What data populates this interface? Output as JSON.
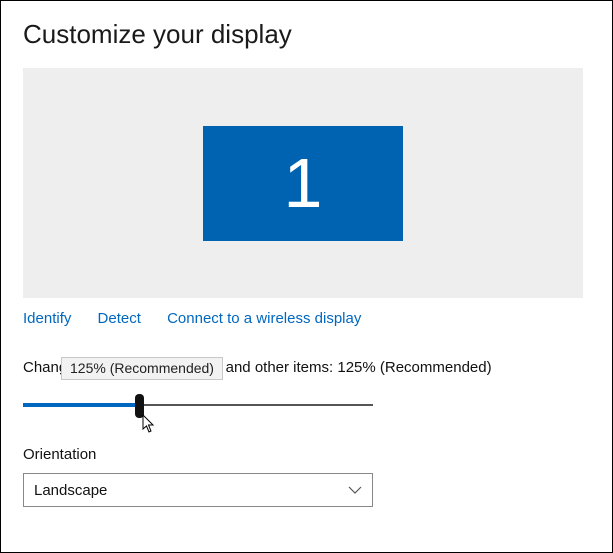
{
  "page_title": "Customize your display",
  "monitor": {
    "id_label": "1"
  },
  "links": {
    "identify": "Identify",
    "detect": "Detect",
    "wireless": "Connect to a wireless display"
  },
  "tooltip": "125% (Recommended)",
  "scale": {
    "label_prefix": "Change the size of text, apps, and other items: ",
    "current_value": "125% (Recommended)"
  },
  "orientation": {
    "label": "Orientation",
    "selected": "Landscape"
  },
  "colors": {
    "accent": "#0067c0",
    "monitor_tile": "#0063b1",
    "preview_bg": "#eeeeee"
  }
}
